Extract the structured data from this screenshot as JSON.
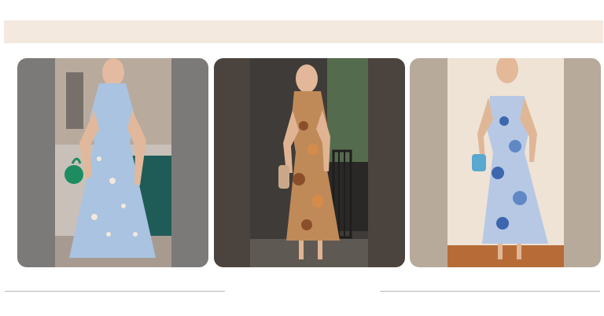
{
  "banner": {
    "color": "#f3e9df"
  },
  "gallery": {
    "items": [
      {
        "icon": "light-blue-floral-maxi-dress-photo",
        "background": "#7d7b79",
        "dress_color": "#a9c3e0",
        "accent_color": "#1d8c61"
      },
      {
        "icon": "brown-orange-floral-midi-dress-photo",
        "background": "#4b433d",
        "dress_color": "#c08a58",
        "accent_color": "#c8a889"
      },
      {
        "icon": "blue-white-floral-slip-dress-photo",
        "background": "#b7aa9b",
        "dress_color": "#5f88c5",
        "accent_color": "#58a8cf"
      }
    ]
  }
}
